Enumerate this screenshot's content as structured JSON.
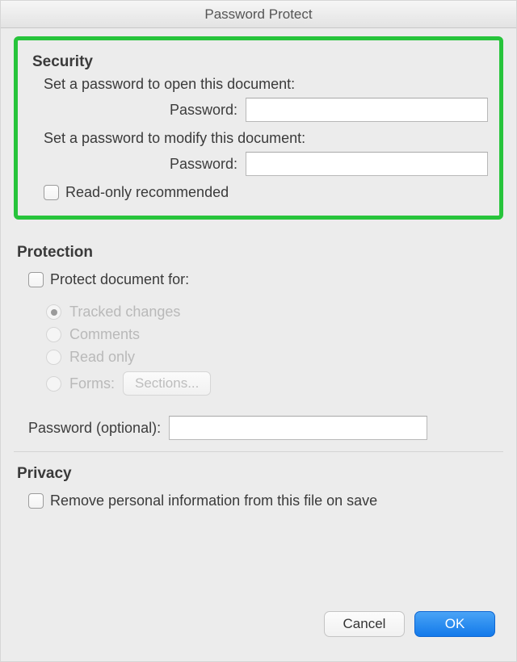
{
  "window": {
    "title": "Password Protect"
  },
  "security": {
    "heading": "Security",
    "open_instruction": "Set a password to open this document:",
    "open_label": "Password:",
    "open_value": "",
    "modify_instruction": "Set a password to modify this document:",
    "modify_label": "Password:",
    "modify_value": "",
    "readonly_label": "Read-only recommended",
    "readonly_checked": false
  },
  "protection": {
    "heading": "Protection",
    "protect_for_label": "Protect document for:",
    "protect_for_checked": false,
    "options": {
      "tracked_changes": "Tracked changes",
      "comments": "Comments",
      "read_only": "Read only",
      "forms": "Forms:",
      "selected": "tracked_changes",
      "enabled": false
    },
    "sections_button": "Sections...",
    "password_optional_label": "Password (optional):",
    "password_optional_value": ""
  },
  "privacy": {
    "heading": "Privacy",
    "remove_personal_label": "Remove personal information from this file on save",
    "remove_personal_checked": false
  },
  "buttons": {
    "cancel": "Cancel",
    "ok": "OK"
  }
}
